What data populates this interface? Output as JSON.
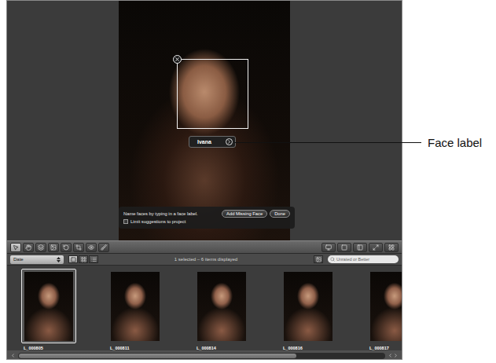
{
  "annotation": {
    "label": "Face label"
  },
  "viewer": {
    "face_label": {
      "name": "Ivana"
    },
    "hud": {
      "instruction": "Name faces by typing in a face label.",
      "checkbox": {
        "label": "Limit suggestions to project",
        "checked": false
      },
      "buttons": [
        "Add Missing Face",
        "Done"
      ]
    }
  },
  "toolbar": {
    "tools": [
      {
        "selected": true
      },
      {
        "selected": false
      },
      {
        "selected": false
      },
      {
        "selected": false
      },
      {
        "selected": false
      },
      {
        "selected": false
      },
      {
        "selected": false
      },
      {
        "selected": false
      }
    ]
  },
  "browser_bar": {
    "sort": "Date",
    "view_modes": [
      {
        "selected": true
      },
      {
        "selected": false
      },
      {
        "selected": false
      }
    ],
    "status": "1 selected – 6 items displayed",
    "search": {
      "placeholder": "Unrated or Better"
    }
  },
  "thumbnails": [
    {
      "label": "L_000805",
      "selected": true
    },
    {
      "label": "L_000811",
      "selected": false
    },
    {
      "label": "L_000814",
      "selected": false
    },
    {
      "label": "L_000816",
      "selected": false
    },
    {
      "label": "L_000817",
      "selected": false
    }
  ],
  "scrollbar": {
    "level": 0.76
  }
}
